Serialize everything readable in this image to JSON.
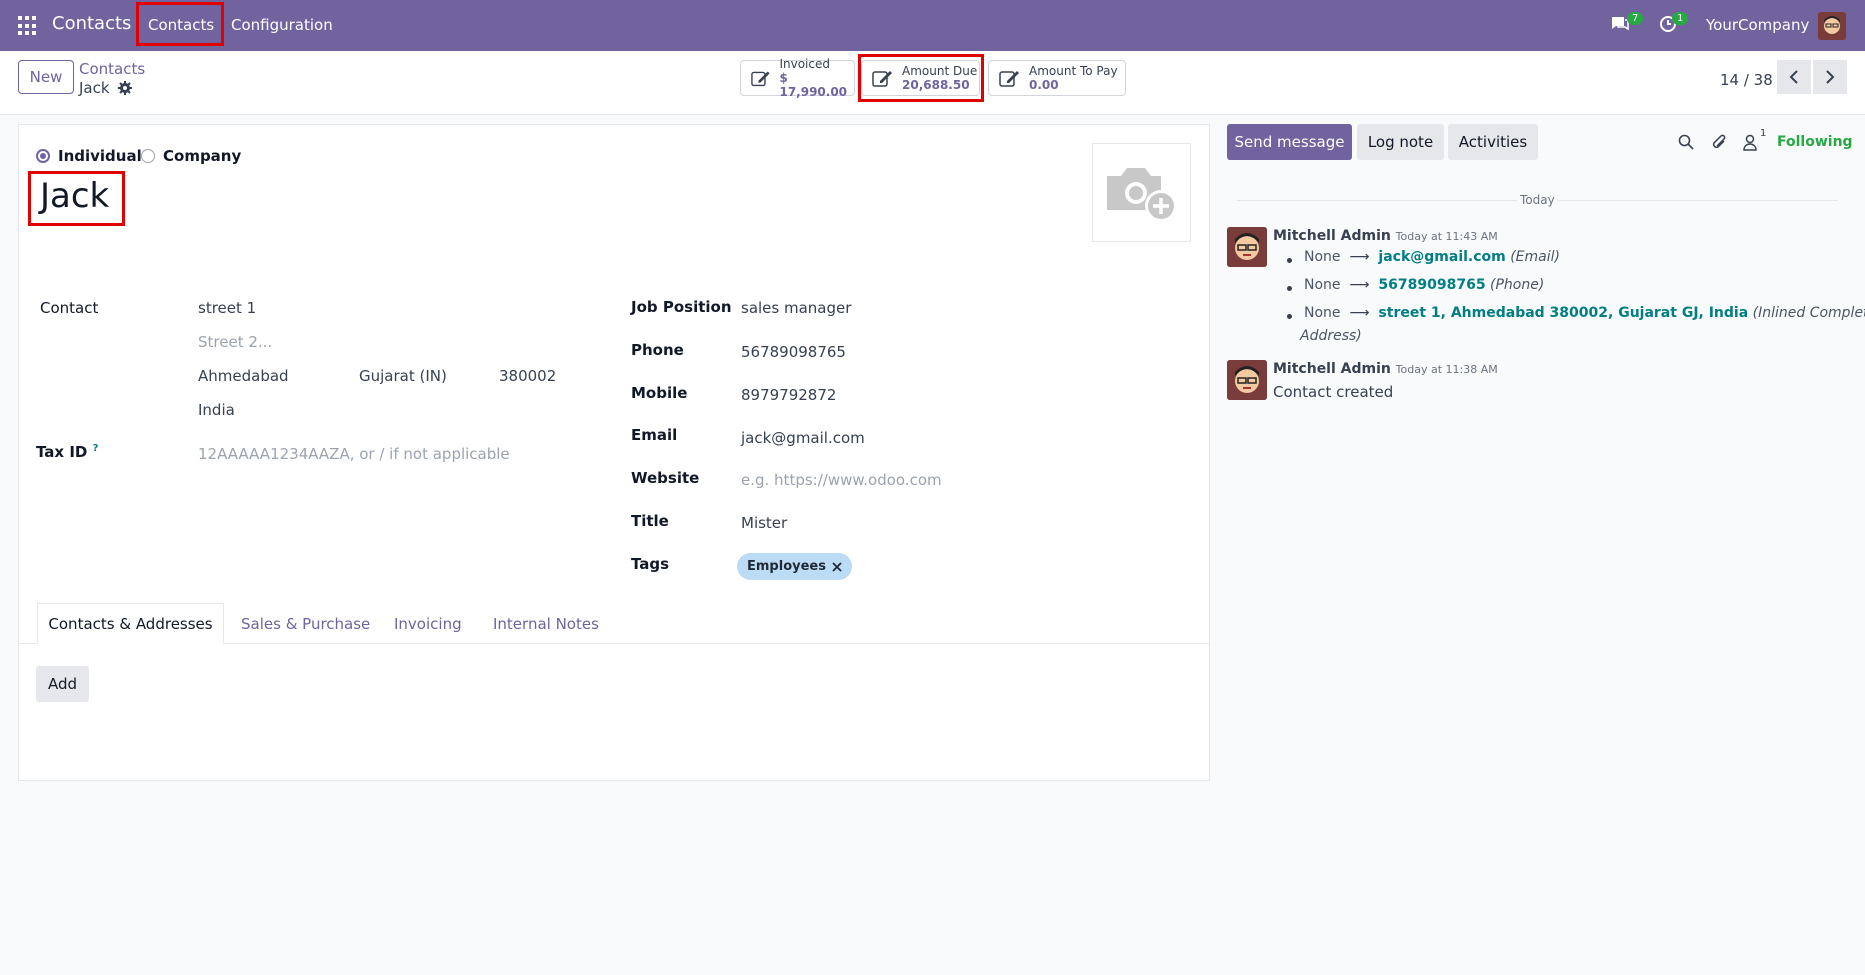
{
  "navbar": {
    "brand": "Contacts",
    "menu": [
      "Contacts",
      "Configuration"
    ],
    "messages_count": "7",
    "activities_count": "1",
    "company": "YourCompany"
  },
  "control": {
    "new_label": "New",
    "breadcrumb_parent": "Contacts",
    "breadcrumb_current": "Jack",
    "stats": [
      {
        "label": "Invoiced",
        "value": "$ 17,990.00"
      },
      {
        "label": "Amount Due",
        "value": "20,688.50"
      },
      {
        "label": "Amount To Pay",
        "value": "0.00"
      }
    ],
    "pager": "14 / 38"
  },
  "form": {
    "type_individual": "Individual",
    "type_company": "Company",
    "name": "Jack",
    "contact_label": "Contact",
    "street": "street 1",
    "street2_placeholder": "Street 2...",
    "city": "Ahmedabad",
    "state": "Gujarat (IN)",
    "zip": "380002",
    "country": "India",
    "tax_label": "Tax ID",
    "tax_help": "?",
    "tax_placeholder": "12AAAAA1234AAZA, or / if not applicable",
    "job_label": "Job Position",
    "job": "sales manager",
    "phone_label": "Phone",
    "phone": "56789098765",
    "mobile_label": "Mobile",
    "mobile": "8979792872",
    "email_label": "Email",
    "email": "jack@gmail.com",
    "website_label": "Website",
    "website_placeholder": "e.g. https://www.odoo.com",
    "title_label": "Title",
    "title": "Mister",
    "tags_label": "Tags",
    "tag": "Employees",
    "tabs": [
      "Contacts & Addresses",
      "Sales & Purchase",
      "Invoicing",
      "Internal Notes"
    ],
    "add_label": "Add"
  },
  "chatter": {
    "send_message": "Send message",
    "log_note": "Log note",
    "activities": "Activities",
    "followers_count": "1",
    "following": "Following",
    "today": "Today",
    "messages": [
      {
        "author": "Mitchell Admin",
        "time": "Today at 11:43 AM",
        "tracking": [
          {
            "old": "None",
            "new": "jack@gmail.com",
            "field": "(Email)"
          },
          {
            "old": "None",
            "new": "56789098765",
            "field": "(Phone)"
          },
          {
            "old": "None",
            "new": "street 1, Ahmedabad 380002, Gujarat GJ, India",
            "field": "(Inlined Complete",
            "field2": "Address)"
          }
        ]
      },
      {
        "author": "Mitchell Admin",
        "time": "Today at 11:38 AM",
        "body": "Contact created"
      }
    ]
  }
}
